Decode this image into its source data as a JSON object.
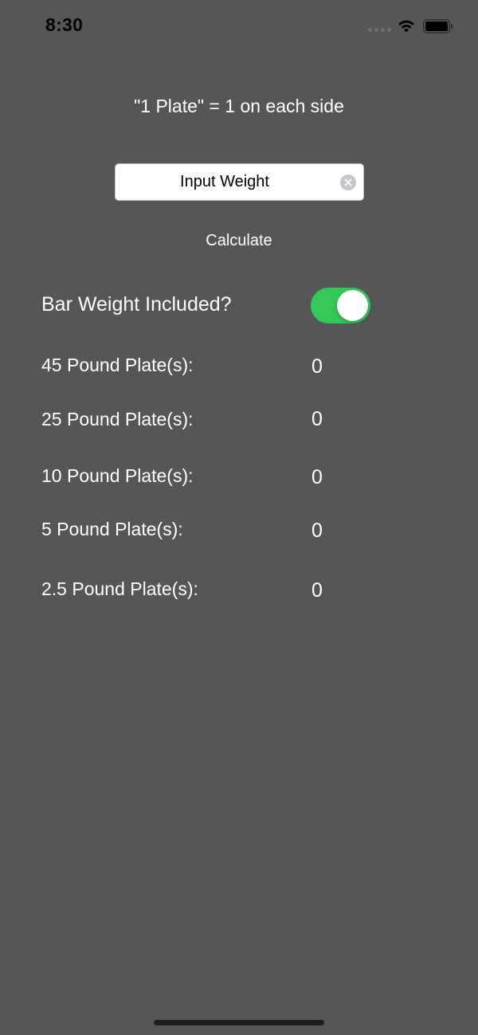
{
  "status_bar": {
    "time": "8:30"
  },
  "header": {
    "note": "\"1 Plate\" = 1 on each side"
  },
  "weight_input": {
    "placeholder": "Input Weight",
    "value": ""
  },
  "calculate": {
    "label": "Calculate"
  },
  "bar_weight": {
    "label": "Bar Weight Included?",
    "enabled": true
  },
  "plates": [
    {
      "label": "45 Pound Plate(s):",
      "value": "0"
    },
    {
      "label": "25 Pound Plate(s):",
      "value": "0"
    },
    {
      "label": "10 Pound Plate(s):",
      "value": "0"
    },
    {
      "label": "5 Pound Plate(s):",
      "value": "0"
    },
    {
      "label": "2.5 Pound Plate(s):",
      "value": "0"
    }
  ],
  "colors": {
    "background": "#565558",
    "toggle_on": "#34c759",
    "text": "#ffffff"
  }
}
